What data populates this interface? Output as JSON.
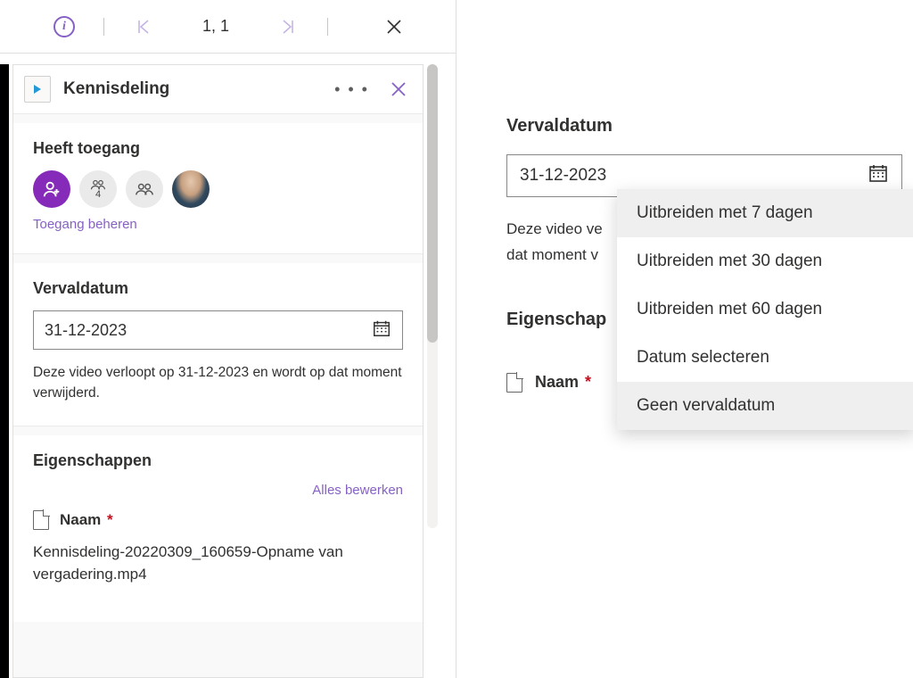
{
  "toolbar": {
    "pager": "1, 1"
  },
  "panel": {
    "title": "Kennisdeling"
  },
  "access": {
    "title": "Heeft toegang",
    "group_count": "4",
    "manage": "Toegang beheren"
  },
  "expiry": {
    "title": "Vervaldatum",
    "date_value": "31-12-2023",
    "note": "Deze video verloopt op 31-12-2023 en wordt op dat moment verwijderd."
  },
  "props": {
    "title": "Eigenschappen",
    "edit_all": "Alles bewerken",
    "name_label": "Naam",
    "required_mark": "*",
    "name_value": "Kennisdeling-20220309_160659-Opname van vergadering.mp4"
  },
  "right": {
    "expiry_title": "Vervaldatum",
    "date_value": "31-12-2023",
    "note_line1": "Deze video ve",
    "note_line2": "dat moment v",
    "eig_label": "Eigenschap",
    "name_label": "Naam",
    "required_mark": "*",
    "menu": {
      "opt7": "Uitbreiden met 7 dagen",
      "opt30": "Uitbreiden met 30 dagen",
      "opt60": "Uitbreiden met 60 dagen",
      "pick": "Datum selecteren",
      "none": "Geen vervaldatum"
    }
  }
}
